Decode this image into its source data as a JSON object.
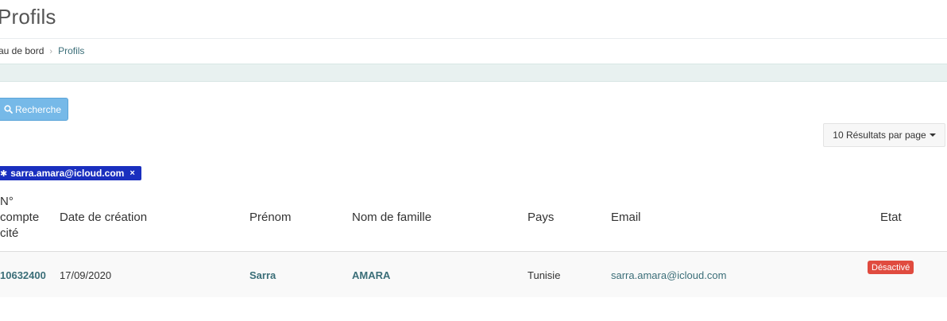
{
  "page": {
    "title": "Profils"
  },
  "breadcrumb": {
    "home": "au de bord",
    "separator": "›",
    "current": "Profils"
  },
  "toolbar": {
    "search_label": "Recherche",
    "per_page_label": "10 Résultats par page"
  },
  "filters": [
    {
      "label": "sarra.amara@icloud.com",
      "remove": "×"
    }
  ],
  "table": {
    "headers": {
      "account_line1": "N°",
      "account_line2": "compte",
      "account_line3": "cité",
      "created": "Date de création",
      "firstname": "Prénom",
      "lastname": "Nom de famille",
      "country": "Pays",
      "email": "Email",
      "status": "Etat"
    },
    "rows": [
      {
        "account": "10632400",
        "created": "17/09/2020",
        "firstname": "Sarra",
        "lastname": "AMARA",
        "country": "Tunisie",
        "email": "sarra.amara@icloud.com",
        "status": "Désactivé"
      }
    ]
  },
  "colors": {
    "button_primary": "#76b9e8",
    "filter_tag": "#1a2fbf",
    "status_disabled": "#e04b3f",
    "link": "#3b6e78",
    "info_bar": "#e8f1f0"
  }
}
